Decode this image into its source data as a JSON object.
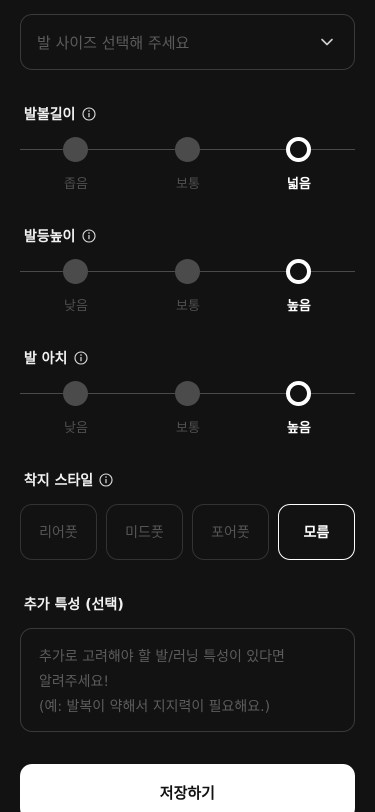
{
  "size_select": {
    "placeholder": "발 사이즈 선택해 주세요",
    "icon": "chevron-down-icon"
  },
  "foot_width": {
    "title": "발볼길이",
    "options": [
      "좁음",
      "보통",
      "넓음"
    ],
    "selected": "넓음"
  },
  "instep_height": {
    "title": "발등높이",
    "options": [
      "낮음",
      "보통",
      "높음"
    ],
    "selected": "높음"
  },
  "foot_arch": {
    "title": "발 아치",
    "options": [
      "낮음",
      "보통",
      "높음"
    ],
    "selected": "높음"
  },
  "landing_style": {
    "title": "착지 스타일",
    "options": [
      "리어풋",
      "미드풋",
      "포어풋",
      "모름"
    ],
    "selected": "모름"
  },
  "extra": {
    "title": "추가 특성 (선택)",
    "placeholder_lines": [
      "추가로 고려해야 할 발/러닝 특성이 있다면",
      "알려주세요!",
      "(예: 발복이 약해서 지지력이 필요해요.)"
    ]
  },
  "save_label": "저장하기",
  "colors": {
    "background": "#121212",
    "accent": "#ffffff",
    "inactive_dot": "#4b4b4b"
  }
}
